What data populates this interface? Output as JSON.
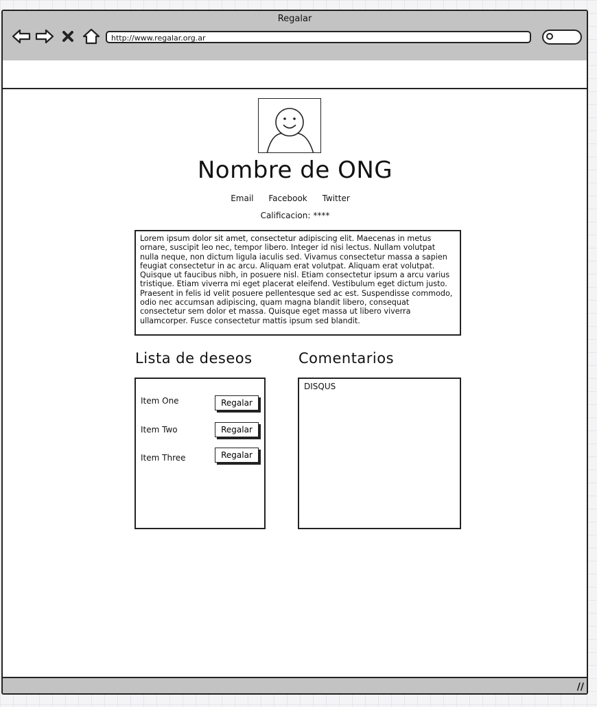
{
  "window": {
    "title": "Regalar",
    "url": "http://www.regalar.org.ar"
  },
  "nav_icons": [
    "back-arrow-icon",
    "forward-arrow-icon",
    "close-icon",
    "home-icon"
  ],
  "profile": {
    "avatar_icon": "user-avatar-icon",
    "org_name": "Nombre de ONG",
    "links": [
      "Email",
      "Facebook",
      "Twitter"
    ],
    "rating_label": "Calificacion:",
    "rating_value": "****"
  },
  "description": "Lorem ipsum dolor sit amet, consectetur adipiscing elit. Maecenas in metus ornare, suscipit leo nec, tempor libero. Integer id nisi lectus. Nullam volutpat nulla neque, non dictum ligula iaculis sed. Vivamus consectetur massa a sapien feugiat consectetur in ac arcu. Aliquam erat volutpat. Aliquam erat volutpat. Quisque ut faucibus nibh, in posuere nisl. Etiam consectetur ipsum a arcu varius tristique. Etiam viverra mi eget placerat eleifend. Vestibulum eget dictum justo. Praesent in felis id velit posuere pellentesque sed ac est. Suspendisse commodo, odio nec accumsan adipiscing, quam magna blandit libero, consequat consectetur sem dolor et massa. Quisque eget massa ut libero viverra ullamcorper. Fusce consectetur mattis ipsum sed blandit.",
  "wishlist": {
    "title": "Lista de deseos",
    "items": [
      {
        "label": "Item One",
        "button": "Regalar"
      },
      {
        "label": "Item Two",
        "button": "Regalar"
      },
      {
        "label": "Item Three",
        "button": "Regalar"
      }
    ]
  },
  "comments": {
    "title": "Comentarios",
    "placeholder": "DISQUS"
  }
}
